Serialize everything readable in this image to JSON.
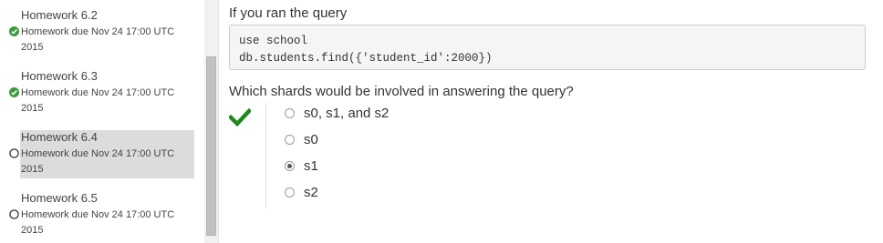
{
  "sidebar": {
    "items": [
      {
        "title": "Homework 6.2",
        "due": "Homework due Nov 24 17:00 UTC 2015",
        "status": "complete"
      },
      {
        "title": "Homework 6.3",
        "due": "Homework due Nov 24 17:00 UTC 2015",
        "status": "complete"
      },
      {
        "title": "Homework 6.4",
        "due": "Homework due Nov 24 17:00 UTC 2015",
        "status": "incomplete",
        "active": true
      },
      {
        "title": "Homework 6.5",
        "due": "Homework due Nov 24 17:00 UTC 2015",
        "status": "incomplete"
      }
    ]
  },
  "problem": {
    "prompt": "If you ran the query",
    "code_lines": [
      "use school",
      "db.students.find({'student_id':2000})"
    ],
    "question": "Which shards would be involved in answering the query?",
    "result_icon": "check-icon",
    "options": [
      {
        "label": "s0, s1, and s2",
        "selected": false
      },
      {
        "label": "s0",
        "selected": false
      },
      {
        "label": "s1",
        "selected": true
      },
      {
        "label": "s2",
        "selected": false
      }
    ]
  },
  "colors": {
    "complete": "#3c9a3c",
    "check": "#1e8a1e",
    "active_item_bg": "#dcdcdc"
  }
}
